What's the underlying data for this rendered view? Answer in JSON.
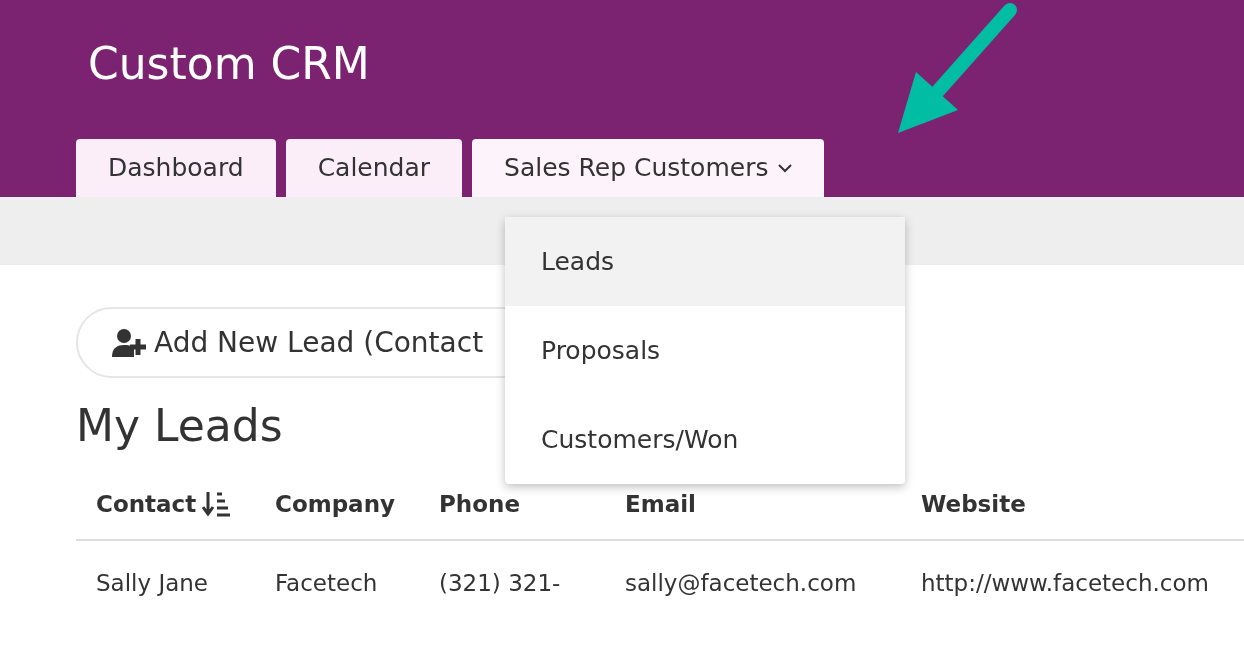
{
  "app": {
    "title": "Custom CRM"
  },
  "tabs": [
    {
      "label": "Dashboard",
      "kind": "link"
    },
    {
      "label": "Calendar",
      "kind": "link"
    },
    {
      "label": "Sales Rep Customers",
      "kind": "dropdown",
      "expanded": true,
      "menu": [
        {
          "label": "Leads",
          "highlighted": true
        },
        {
          "label": "Proposals",
          "highlighted": false
        },
        {
          "label": "Customers/Won",
          "highlighted": false
        }
      ]
    }
  ],
  "add_button": {
    "label": "Add New Lead (Contact"
  },
  "heading": "My Leads",
  "table": {
    "columns": [
      {
        "label": "Contact",
        "sorted": true
      },
      {
        "label": "Company",
        "sorted": false
      },
      {
        "label": "Phone",
        "sorted": false
      },
      {
        "label": "Email",
        "sorted": false
      },
      {
        "label": "Website",
        "sorted": false
      }
    ],
    "rows": [
      [
        "Sally Jane",
        "Facetech",
        "(321) 321-",
        "sally@facetech.com",
        "http://www.facetech.com"
      ]
    ]
  }
}
